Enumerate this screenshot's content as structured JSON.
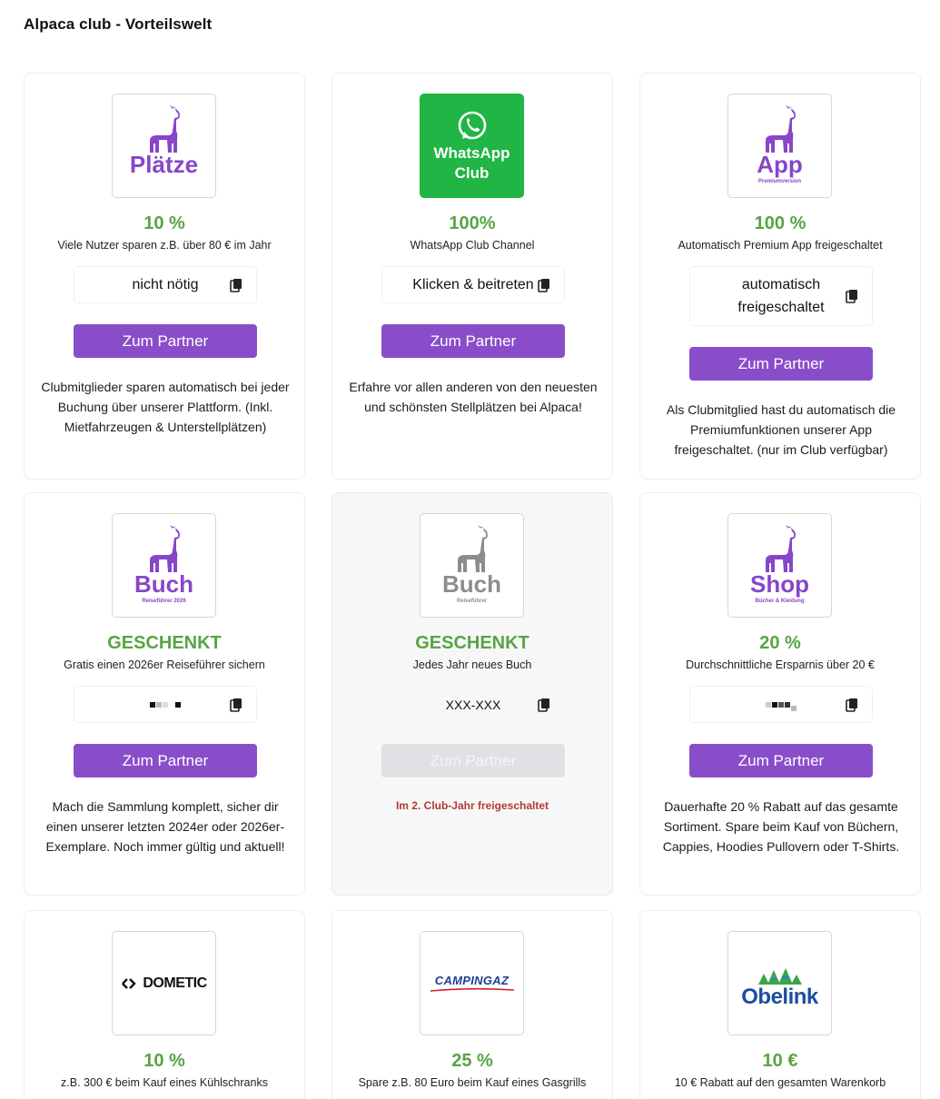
{
  "page": {
    "title": "Alpaca club - Vorteilswelt"
  },
  "colors": {
    "accent_purple": "#8a4dc9",
    "value_green": "#58a443",
    "whatsapp_green": "#20b545",
    "locked_red": "#b23a35"
  },
  "cards": [
    {
      "logo": {
        "word": "Plätze",
        "icon": "llama-icon"
      },
      "value": "10 %",
      "subtitle": "Viele Nutzer sparen z.B. über 80 € im Jahr",
      "code": "nicht nötig",
      "button": "Zum Partner",
      "description": "Clubmitglieder sparen automatisch bei jeder Buchung über unserer Plattform. (Inkl. Mietfahrzeugen & Unterstellplätzen)"
    },
    {
      "logo": {
        "line1": "WhatsApp",
        "line2": "Club",
        "icon": "whatsapp-icon"
      },
      "value": "100%",
      "subtitle": "WhatsApp Club Channel",
      "code": "Klicken & beitreten",
      "button": "Zum Partner",
      "description": "Erfahre vor allen anderen von den neuesten und schönsten Stellplätzen bei Alpaca!"
    },
    {
      "logo": {
        "word": "App",
        "sub": "Premiumversion",
        "icon": "llama-icon"
      },
      "value": "100 %",
      "subtitle": "Automatisch Premium App freigeschaltet",
      "code_line1": "automatisch",
      "code_line2": "freigeschaltet",
      "button": "Zum Partner",
      "description": "Als Clubmitglied hast du automatisch die Premiumfunktionen unserer App freigeschaltet. (nur im Club verfügbar)"
    },
    {
      "logo": {
        "word": "Buch",
        "sub": "Reiseführer 2026",
        "icon": "llama-icon"
      },
      "value": "GESCHENKT",
      "subtitle": "Gratis einen 2026er Reiseführer sichern",
      "code": "masked",
      "button": "Zum Partner",
      "description": "Mach die Sammlung komplett, sicher dir einen unserer letzten 2024er oder 2026er-Exemplare. Noch immer gültig und aktuell!"
    },
    {
      "logo": {
        "word": "Buch",
        "sub": "Reiseführer",
        "icon": "llama-icon"
      },
      "value": "GESCHENKT",
      "subtitle": "Jedes Jahr neues Buch",
      "code": "XXX-XXX",
      "button": "Zum Partner",
      "locked_note": "Im 2. Club-Jahr freigeschaltet"
    },
    {
      "logo": {
        "word": "Shop",
        "sub": "Bücher & Kleidung",
        "icon": "llama-icon"
      },
      "value": "20 %",
      "subtitle": "Durchschnittliche Ersparnis über 20 €",
      "code": "masked",
      "button": "Zum Partner",
      "description": "Dauerhafte 20 % Rabatt auf das gesamte Sortiment. Spare beim Kauf von Büchern, Cappies, Hoodies Pullovern oder T-Shirts."
    },
    {
      "logo": {
        "brand": "DOMETIC",
        "icon": "dometic-logo-icon"
      },
      "value": "10 %",
      "subtitle": "z.B. 300 € beim Kauf eines Kühlschranks"
    },
    {
      "logo": {
        "brand": "CAMPINGAZ",
        "icon": "campingaz-logo-icon"
      },
      "value": "25 %",
      "subtitle": "Spare z.B. 80 Euro beim Kauf eines Gasgrills"
    },
    {
      "logo": {
        "brand": "Obelink",
        "icon": "obelink-logo-icon"
      },
      "value": "10 €",
      "subtitle": "10 € Rabatt auf den gesamten Warenkorb"
    }
  ]
}
